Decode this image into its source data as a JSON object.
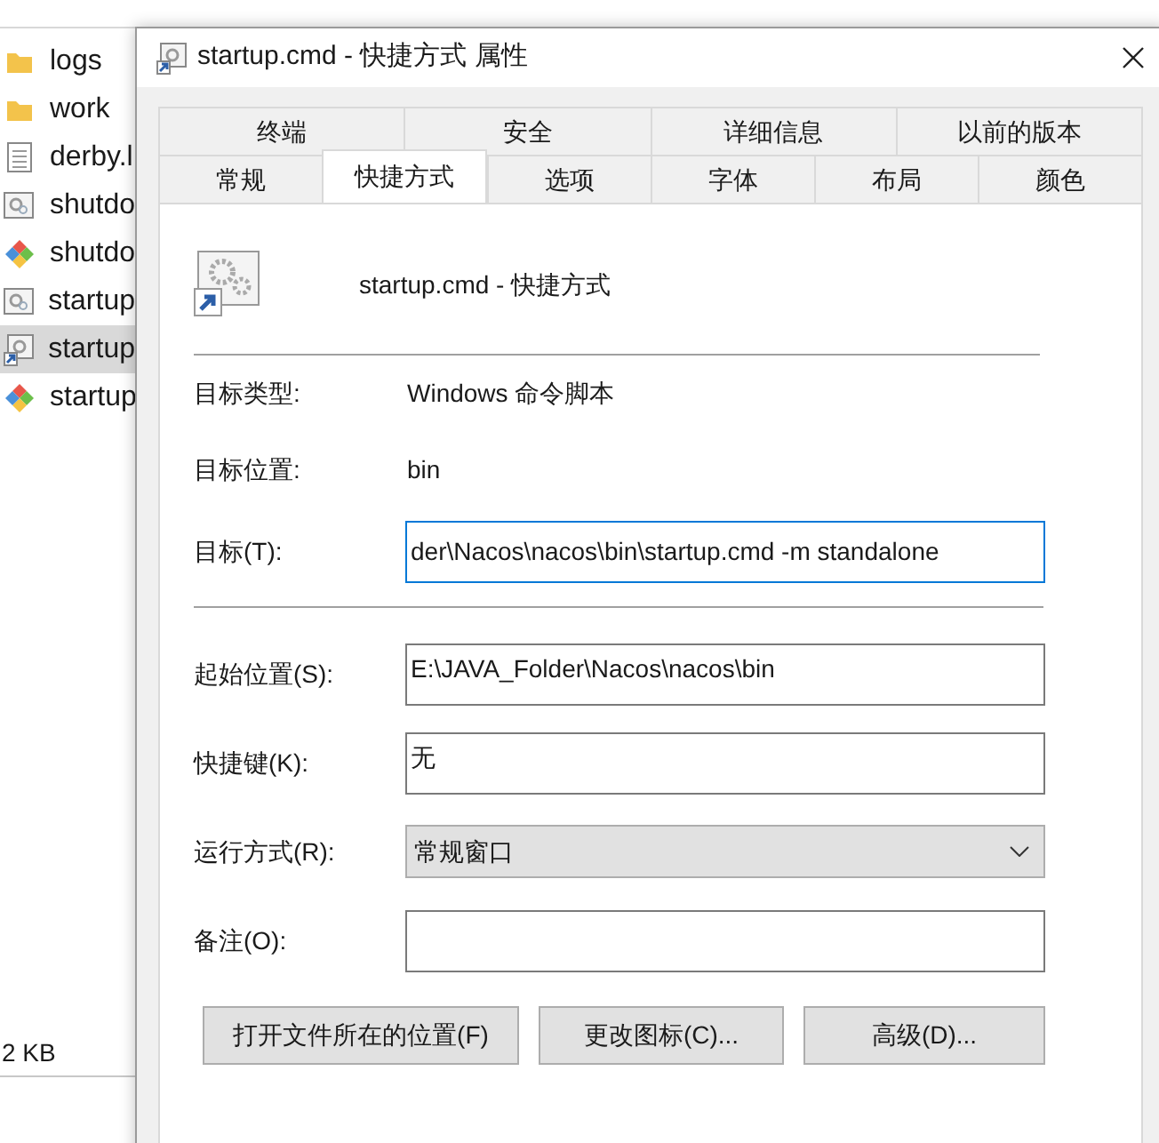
{
  "explorer": {
    "files": [
      {
        "name": "logs",
        "kind": "folder",
        "selected": false
      },
      {
        "name": "work",
        "kind": "folder",
        "selected": false
      },
      {
        "name": "derby.l",
        "kind": "text",
        "selected": false
      },
      {
        "name": "shutdo",
        "kind": "script",
        "selected": false
      },
      {
        "name": "shutdo",
        "kind": "git",
        "selected": false
      },
      {
        "name": "startup",
        "kind": "script",
        "selected": false
      },
      {
        "name": "startup",
        "kind": "shortcut",
        "selected": true
      },
      {
        "name": "startup",
        "kind": "git",
        "selected": false
      }
    ],
    "status_bar": "2 KB"
  },
  "dialog": {
    "title": "startup.cmd - 快捷方式 属性",
    "tab_rows": [
      [
        {
          "label": "终端",
          "selected": false
        },
        {
          "label": "安全",
          "selected": false
        },
        {
          "label": "详细信息",
          "selected": false
        },
        {
          "label": "以前的版本",
          "selected": false
        }
      ],
      [
        {
          "label": "常规",
          "selected": false
        },
        {
          "label": "快捷方式",
          "selected": true
        },
        {
          "label": "选项",
          "selected": false
        },
        {
          "label": "字体",
          "selected": false
        },
        {
          "label": "布局",
          "selected": false
        },
        {
          "label": "颜色",
          "selected": false
        }
      ]
    ],
    "shortcut_name": "startup.cmd - 快捷方式",
    "info": [
      {
        "label": "目标类型:",
        "value": "Windows 命令脚本"
      },
      {
        "label": "目标位置:",
        "value": "bin"
      }
    ],
    "target": {
      "label": "目标(T):",
      "value": "der\\Nacos\\nacos\\bin\\startup.cmd -m standalone",
      "focused": true
    },
    "fields": [
      {
        "label": "起始位置(S):",
        "value": "E:\\JAVA_Folder\\Nacos\\nacos\\bin",
        "kind": "input"
      },
      {
        "label": "快捷键(K):",
        "value": "无",
        "kind": "input"
      },
      {
        "label": "运行方式(R):",
        "value": "常规窗口",
        "kind": "select"
      },
      {
        "label": "备注(O):",
        "kind": "input"
      }
    ],
    "buttons": [
      "打开文件所在的位置(F)",
      "更改图标(C)...",
      "高级(D)..."
    ]
  }
}
